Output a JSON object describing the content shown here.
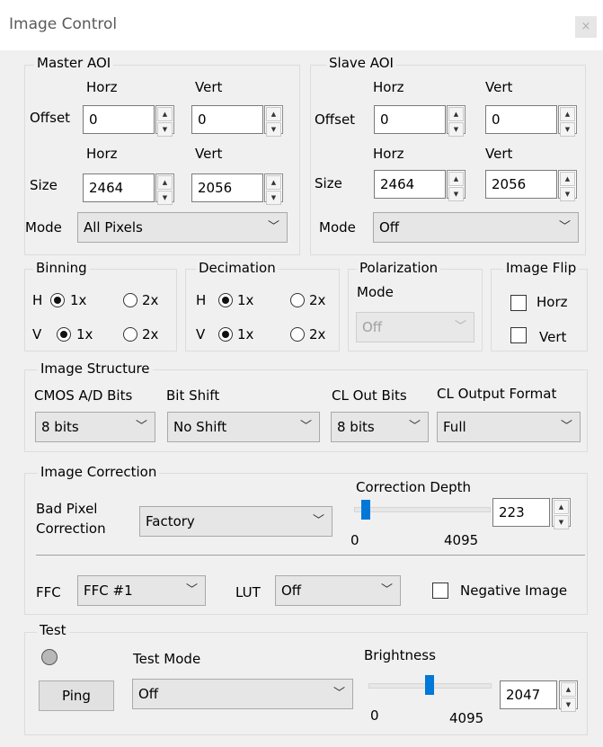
{
  "window": {
    "title": "Image Control",
    "close_glyph": "×"
  },
  "master_aoi": {
    "group_label": "Master AOI",
    "horz_label": "Horz",
    "vert_label": "Vert",
    "offset_label": "Offset",
    "size_label": "Size",
    "mode_label": "Mode",
    "offset_horz": "0",
    "offset_vert": "0",
    "size_horz": "2464",
    "size_vert": "2056",
    "mode_value": "All Pixels"
  },
  "slave_aoi": {
    "group_label": "Slave AOI",
    "horz_label": "Horz",
    "vert_label": "Vert",
    "offset_label": "Offset",
    "size_label": "Size",
    "mode_label": "Mode",
    "offset_horz": "0",
    "offset_vert": "0",
    "size_horz": "2464",
    "size_vert": "2056",
    "mode_value": "Off"
  },
  "binning": {
    "group_label": "Binning",
    "h_label": "H",
    "v_label": "V",
    "opt1": "1x",
    "opt2": "2x",
    "h_selected": "1x",
    "v_selected": "1x"
  },
  "decimation": {
    "group_label": "Decimation",
    "h_label": "H",
    "v_label": "V",
    "opt1": "1x",
    "opt2": "2x",
    "h_selected": "1x",
    "v_selected": "1x"
  },
  "polarization": {
    "group_label": "Polarization",
    "mode_label": "Mode",
    "mode_value": "Off",
    "enabled": false
  },
  "image_flip": {
    "group_label": "Image Flip",
    "horz_label": "Horz",
    "vert_label": "Vert",
    "horz_checked": false,
    "vert_checked": false
  },
  "image_structure": {
    "group_label": "Image Structure",
    "cmos_label": "CMOS A/D Bits",
    "cmos_value": "8 bits",
    "bitshift_label": "Bit Shift",
    "bitshift_value": "No Shift",
    "clout_label": "CL Out Bits",
    "clout_value": "8 bits",
    "clformat_label": "CL Output Format",
    "clformat_value": "Full"
  },
  "image_correction": {
    "group_label": "Image Correction",
    "bad_pixel_label_line1": "Bad Pixel",
    "bad_pixel_label_line2": "Correction",
    "bad_pixel_value": "Factory",
    "depth_label": "Correction Depth",
    "depth_value": "223",
    "depth_min": "0",
    "depth_max": "4095",
    "depth_position": 0.054,
    "ffc_label": "FFC",
    "ffc_value": "FFC #1",
    "lut_label": "LUT",
    "lut_value": "Off",
    "negative_label": "Negative Image",
    "negative_checked": false
  },
  "test": {
    "group_label": "Test",
    "ping_label": "Ping",
    "mode_label": "Test Mode",
    "mode_value": "Off",
    "brightness_label": "Brightness",
    "brightness_value": "2047",
    "brightness_min": "0",
    "brightness_max": "4095",
    "brightness_position": 0.5
  },
  "colors": {
    "accent": "#0078d7",
    "background": "#f0f0f0",
    "group_border": "#dcdcdc"
  },
  "icons": {
    "spin": "spin-updown-icon",
    "combo": "chevron-down-icon",
    "led": "status-led-icon"
  }
}
